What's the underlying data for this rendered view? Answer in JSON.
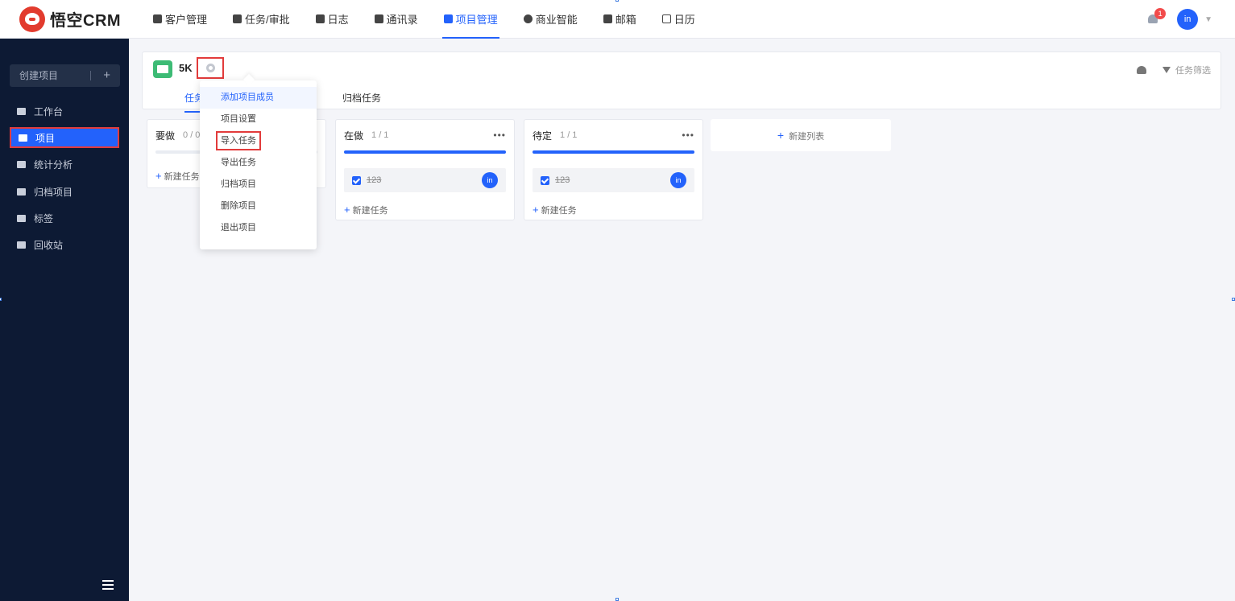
{
  "app": {
    "logo_text": "悟空CRM"
  },
  "topnav": {
    "items": [
      {
        "label": "客户管理",
        "icon": "building-icon"
      },
      {
        "label": "任务/审批",
        "icon": "briefcase-icon"
      },
      {
        "label": "日志",
        "icon": "notebook-icon"
      },
      {
        "label": "通讯录",
        "icon": "contacts-icon"
      },
      {
        "label": "项目管理",
        "icon": "project-icon",
        "active": true
      },
      {
        "label": "商业智能",
        "icon": "shield-icon"
      },
      {
        "label": "邮箱",
        "icon": "mail-icon"
      },
      {
        "label": "日历",
        "icon": "calendar-icon"
      }
    ],
    "notification_count": "1",
    "avatar_text": "in",
    "accent": "#2362fb"
  },
  "sidebar": {
    "create_label": "创建项目",
    "create_plus": "+",
    "items": [
      {
        "label": "工作台",
        "icon": "monitor-icon"
      },
      {
        "label": "项目",
        "icon": "project-icon",
        "active": true
      },
      {
        "label": "统计分析",
        "icon": "bar-chart-icon"
      },
      {
        "label": "归档项目",
        "icon": "archive-icon"
      },
      {
        "label": "标签",
        "icon": "tag-icon"
      },
      {
        "label": "回收站",
        "icon": "trash-icon"
      }
    ]
  },
  "project": {
    "name": "5K",
    "tabs": [
      {
        "label": "任务",
        "active": true
      },
      {
        "label": "归档任务"
      }
    ],
    "filter_label": "任务筛选"
  },
  "columns": [
    {
      "title": "要做",
      "count": "0 / 0",
      "progress": 0,
      "tasks": [],
      "new_task": "新建任务"
    },
    {
      "title": "在做",
      "count": "1 / 1",
      "progress": 1,
      "tasks": [
        {
          "title": "123",
          "done": true,
          "assignee": "in"
        }
      ],
      "new_task": "新建任务"
    },
    {
      "title": "待定",
      "count": "1 / 1",
      "progress": 1,
      "tasks": [
        {
          "title": "123",
          "done": true,
          "assignee": "in"
        }
      ],
      "new_task": "新建任务"
    }
  ],
  "new_list_label": "新建列表",
  "dropdown": {
    "items": [
      {
        "label": "添加项目成员",
        "hover": true
      },
      {
        "label": "项目设置"
      },
      {
        "label": "导入任务",
        "boxed": true
      },
      {
        "label": "导出任务"
      },
      {
        "label": "归档项目"
      },
      {
        "label": "删除项目"
      },
      {
        "label": "退出项目"
      }
    ]
  },
  "highlight_color": "#e23b3b"
}
